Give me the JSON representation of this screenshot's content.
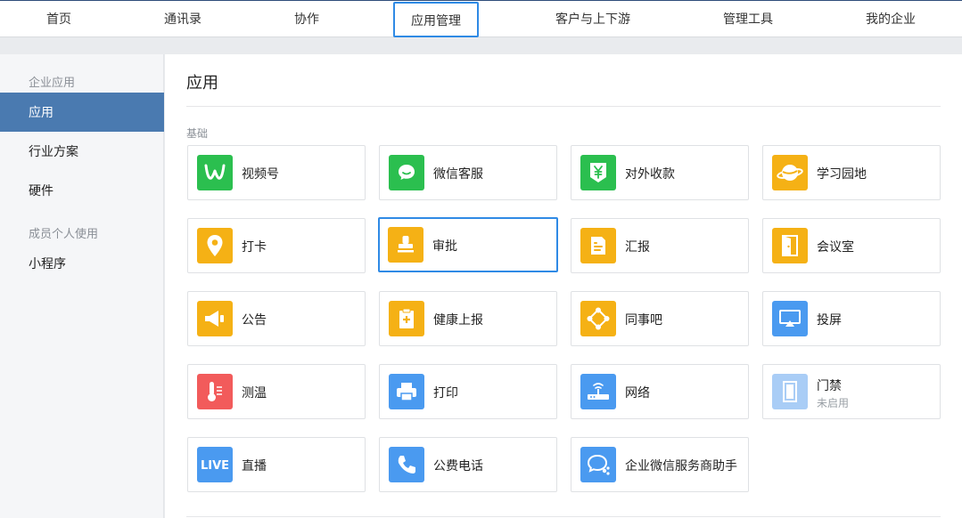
{
  "nav": {
    "items": [
      {
        "label": "首页"
      },
      {
        "label": "通讯录"
      },
      {
        "label": "协作"
      },
      {
        "label": "应用管理"
      },
      {
        "label": "客户与上下游"
      },
      {
        "label": "管理工具"
      },
      {
        "label": "我的企业"
      }
    ],
    "active": "应用管理"
  },
  "sidebar": {
    "group1": "企业应用",
    "items1": [
      {
        "label": "应用"
      },
      {
        "label": "行业方案"
      },
      {
        "label": "硬件"
      }
    ],
    "group2": "成员个人使用",
    "items2": [
      {
        "label": "小程序"
      }
    ],
    "active": "应用"
  },
  "main": {
    "title": "应用",
    "section": "基础",
    "apps": [
      {
        "name": "视频号",
        "icon": "channels-icon",
        "color": "#2bbf4f"
      },
      {
        "name": "微信客服",
        "icon": "wechat-service-icon",
        "color": "#2bbf4f"
      },
      {
        "name": "对外收款",
        "icon": "yuan-payment-icon",
        "color": "#2bbf4f"
      },
      {
        "name": "学习园地",
        "icon": "planet-icon",
        "color": "#f5b115"
      },
      {
        "name": "打卡",
        "icon": "location-pin-icon",
        "color": "#f5b115"
      },
      {
        "name": "审批",
        "icon": "stamp-icon",
        "color": "#f5b115"
      },
      {
        "name": "汇报",
        "icon": "report-icon",
        "color": "#f5b115"
      },
      {
        "name": "会议室",
        "icon": "door-icon",
        "color": "#f5b115"
      },
      {
        "name": "公告",
        "icon": "megaphone-icon",
        "color": "#f5b115"
      },
      {
        "name": "健康上报",
        "icon": "health-report-icon",
        "color": "#f5b115"
      },
      {
        "name": "同事吧",
        "icon": "network-nodes-icon",
        "color": "#f5b115"
      },
      {
        "name": "投屏",
        "icon": "screen-cast-icon",
        "color": "#4a9af0"
      },
      {
        "name": "测温",
        "icon": "thermometer-icon",
        "color": "#f25b5b"
      },
      {
        "name": "打印",
        "icon": "printer-icon",
        "color": "#4a9af0"
      },
      {
        "name": "网络",
        "icon": "router-icon",
        "color": "#4a9af0"
      },
      {
        "name": "门禁",
        "icon": "access-door-icon",
        "color": "#a9cdf6",
        "status": "未启用"
      },
      {
        "name": "直播",
        "icon": "live-icon",
        "color": "#4a9af0"
      },
      {
        "name": "公费电话",
        "icon": "phone-icon",
        "color": "#4a9af0"
      },
      {
        "name": "企业微信服务商助手",
        "icon": "service-assistant-icon",
        "color": "#4a9af0"
      }
    ],
    "selected": "审批"
  }
}
